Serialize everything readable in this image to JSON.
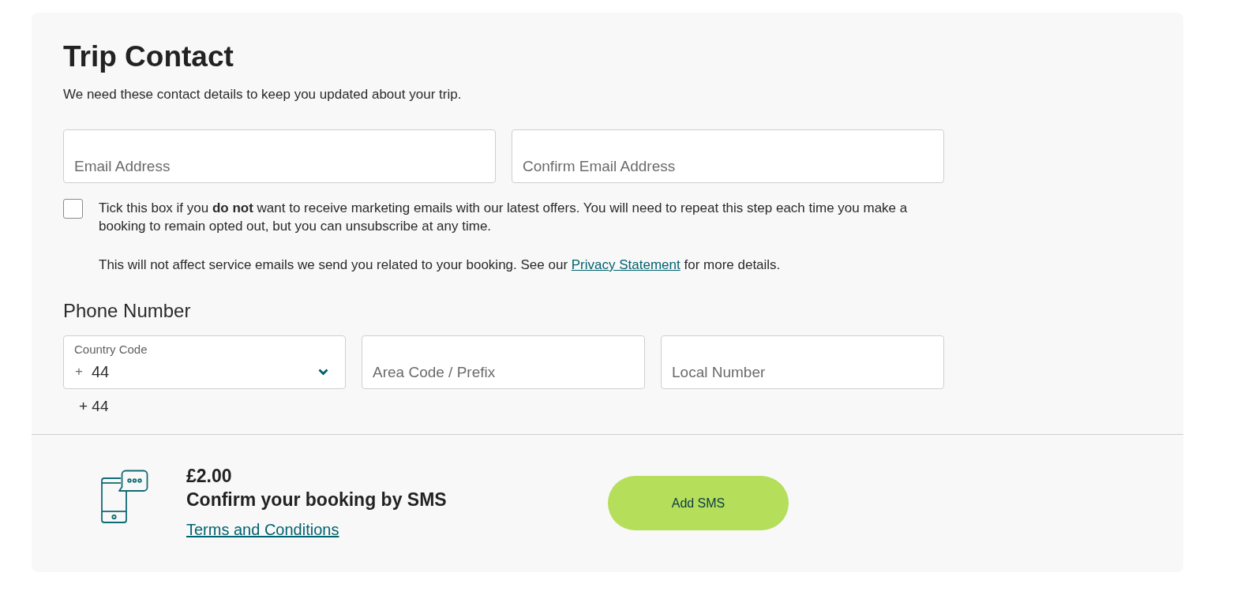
{
  "title": "Trip Contact",
  "subtitle": "We need these contact details to keep you updated about your trip.",
  "email_fields": [
    {
      "placeholder": "Email Address"
    },
    {
      "placeholder": "Confirm Email Address"
    }
  ],
  "marketing_opt_out": {
    "checked": false,
    "text": "Tick this box if you **do not** want to receive marketing emails with our latest offers. You will need to repeat this step each time you make a booking to remain opted out, but you can unsubscribe at any time.",
    "note": {
      "text_before": "This will not affect service emails we send you related to your booking. See our",
      "link": "Privacy Statement",
      "text_after": "for more details."
    }
  },
  "phone": {
    "heading": "Phone Number",
    "country_code": {
      "label": "Country Code",
      "prefix": "+",
      "value": "44"
    },
    "fields": [
      {
        "placeholder": "Area Code / Prefix"
      },
      {
        "placeholder": "Local Number"
      }
    ],
    "caption": "+ 44"
  },
  "sms_offer": {
    "price": "£2.00",
    "title": "Confirm your booking by SMS",
    "link": "Terms and Conditions",
    "button": "Add SMS"
  }
}
